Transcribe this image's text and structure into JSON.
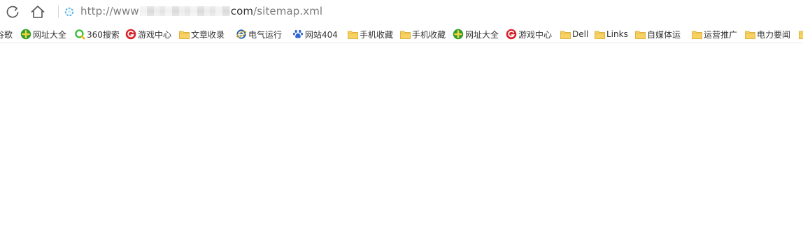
{
  "address_bar": {
    "url_prefix": "http://www",
    "url_suffix": "com",
    "url_path": "/sitemap.xml"
  },
  "icons": {
    "refresh": "refresh-icon",
    "home": "home-icon",
    "site": "page-loading-icon"
  },
  "bookmarks": [
    {
      "label": "谷歌",
      "icon": "none"
    },
    {
      "label": "网址大全",
      "icon": "green-plus-icon"
    },
    {
      "label": "360搜索",
      "icon": "360-search-icon"
    },
    {
      "label": "游戏中心",
      "icon": "game-center-icon"
    },
    {
      "label": "文章收录",
      "icon": "folder-icon"
    },
    {
      "label": "电气运行",
      "icon": "ie-icon"
    },
    {
      "label": "网站404",
      "icon": "baidu-paw-icon"
    },
    {
      "label": "手机收藏",
      "icon": "folder-icon"
    },
    {
      "label": "手机收藏",
      "icon": "folder-icon"
    },
    {
      "label": "网址大全",
      "icon": "green-plus-icon"
    },
    {
      "label": "游戏中心",
      "icon": "game-center-icon"
    },
    {
      "label": "Dell",
      "icon": "folder-icon"
    },
    {
      "label": "Links",
      "icon": "folder-icon"
    },
    {
      "label": "自媒体运",
      "icon": "folder-icon"
    },
    {
      "label": "运营推广",
      "icon": "folder-icon"
    },
    {
      "label": "电力要闻",
      "icon": "folder-icon"
    },
    {
      "label": "",
      "icon": "folder-icon"
    }
  ],
  "colors": {
    "folder": "#f7d162",
    "folder_dark": "#e0b343",
    "green_plus": "#2f9e2f",
    "game_red": "#d8232a",
    "ie_blue": "#1f5fae",
    "baidu_blue": "#2b67d6",
    "search_green": "#3dbd3d",
    "site_icon": "#5db3e6"
  }
}
